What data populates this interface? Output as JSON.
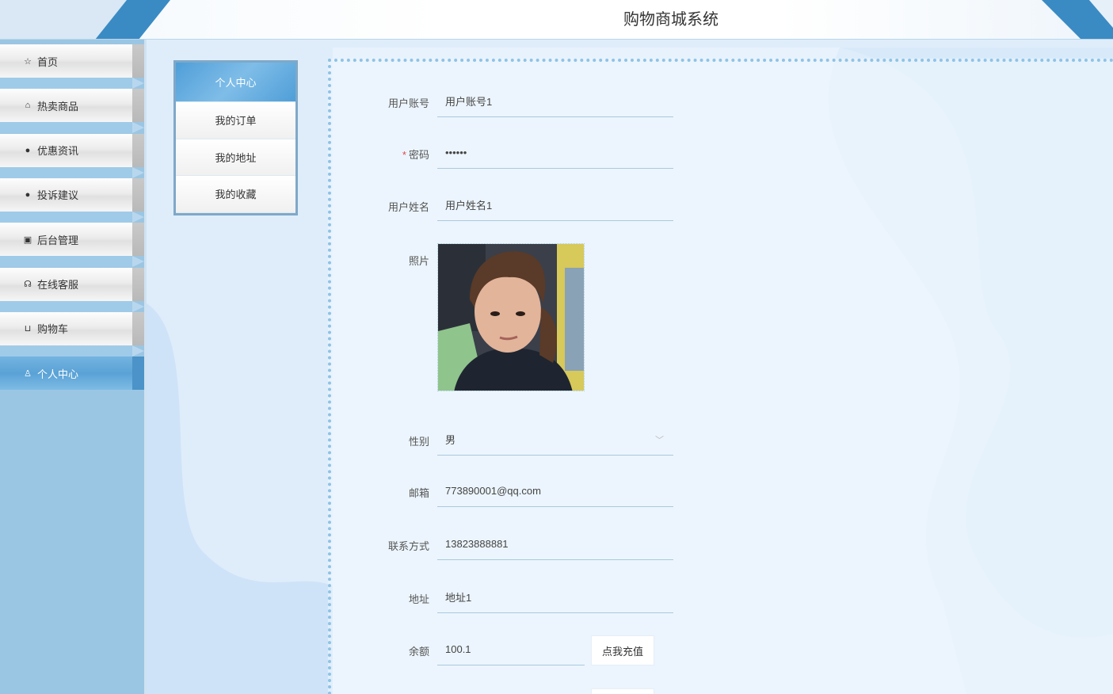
{
  "app": {
    "title": "购物商城系统"
  },
  "sidebar": {
    "items": [
      {
        "label": "首页",
        "icon": "star-icon",
        "glyph": "☆",
        "active": false
      },
      {
        "label": "热卖商品",
        "icon": "shopping-bag-icon",
        "glyph": "⌂",
        "active": false
      },
      {
        "label": "优惠资讯",
        "icon": "info-circle-icon",
        "glyph": "●",
        "active": false
      },
      {
        "label": "投诉建议",
        "icon": "question-circle-icon",
        "glyph": "●",
        "active": false
      },
      {
        "label": "后台管理",
        "icon": "gift-icon",
        "glyph": "▣",
        "active": false
      },
      {
        "label": "在线客服",
        "icon": "headset-icon",
        "glyph": "☊",
        "active": false
      },
      {
        "label": "购物车",
        "icon": "cart-icon",
        "glyph": "⊔",
        "active": false
      },
      {
        "label": "个人中心",
        "icon": "user-icon",
        "glyph": "♙",
        "active": true
      }
    ]
  },
  "submenu": {
    "items": [
      {
        "label": "个人中心",
        "active": true
      },
      {
        "label": "我的订单",
        "active": false
      },
      {
        "label": "我的地址",
        "active": false
      },
      {
        "label": "我的收藏",
        "active": false
      }
    ]
  },
  "form": {
    "account": {
      "label": "用户账号",
      "value": "用户账号1"
    },
    "password": {
      "label": "密码",
      "required_mark": "*",
      "value": "••••••"
    },
    "name": {
      "label": "用户姓名",
      "value": "用户姓名1"
    },
    "photo": {
      "label": "照片"
    },
    "gender": {
      "label": "性别",
      "value": "男"
    },
    "email": {
      "label": "邮箱",
      "value": "773890001@qq.com"
    },
    "phone": {
      "label": "联系方式",
      "value": "13823888881"
    },
    "address": {
      "label": "地址",
      "value": "地址1"
    },
    "balance": {
      "label": "余额",
      "value": "100.1",
      "recharge_label": "点我充值"
    }
  },
  "colors": {
    "accent": "#5aa2d6",
    "sidebar_bg": "#9bc6e3",
    "required": "#e0484c"
  }
}
